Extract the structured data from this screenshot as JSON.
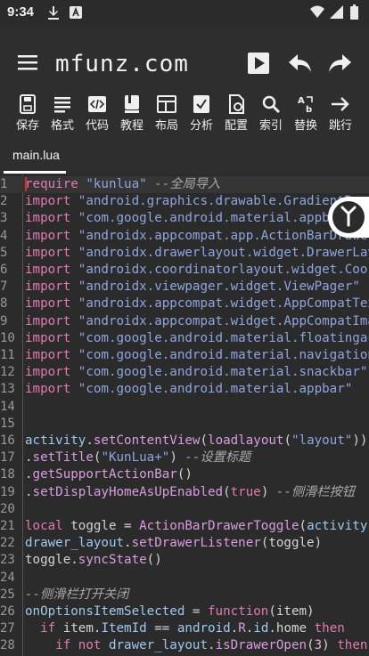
{
  "status_bar": {
    "time": "9:34"
  },
  "app_bar": {
    "title": "mfunz.com"
  },
  "toolbar": {
    "items": [
      {
        "label": "保存",
        "icon": "save-icon"
      },
      {
        "label": "格式",
        "icon": "format-icon"
      },
      {
        "label": "代码",
        "icon": "code-icon"
      },
      {
        "label": "教程",
        "icon": "book-icon"
      },
      {
        "label": "布局",
        "icon": "layout-icon"
      },
      {
        "label": "分析",
        "icon": "analyze-icon"
      },
      {
        "label": "配置",
        "icon": "config-icon"
      },
      {
        "label": "索引",
        "icon": "search-icon"
      },
      {
        "label": "替换",
        "icon": "replace-icon"
      },
      {
        "label": "跳行",
        "icon": "goto-line-icon"
      }
    ]
  },
  "tabs": [
    {
      "label": "main.lua",
      "active": true
    }
  ],
  "editor": {
    "lines": [
      {
        "n": "1",
        "segs": [
          [
            "kw",
            "require"
          ],
          [
            "pl",
            " "
          ],
          [
            "str",
            "\"kunlua\""
          ],
          [
            "pl",
            " "
          ],
          [
            "cm",
            "--全局导入"
          ]
        ]
      },
      {
        "n": "2",
        "segs": [
          [
            "kw",
            "import"
          ],
          [
            "pl",
            " "
          ],
          [
            "str",
            "\"android.graphics.drawable.GradientDrawable\""
          ]
        ]
      },
      {
        "n": "3",
        "segs": [
          [
            "kw",
            "import"
          ],
          [
            "pl",
            " "
          ],
          [
            "str",
            "\"com.google.android.material.appbar.AppBarLayout\""
          ]
        ]
      },
      {
        "n": "4",
        "segs": [
          [
            "kw",
            "import"
          ],
          [
            "pl",
            " "
          ],
          [
            "str",
            "\"androidx.appcompat.app.ActionBarDrawerToggle\""
          ]
        ]
      },
      {
        "n": "5",
        "segs": [
          [
            "kw",
            "import"
          ],
          [
            "pl",
            " "
          ],
          [
            "str",
            "\"androidx.drawerlayout.widget.DrawerLayout\""
          ]
        ]
      },
      {
        "n": "6",
        "segs": [
          [
            "kw",
            "import"
          ],
          [
            "pl",
            " "
          ],
          [
            "str",
            "\"androidx.coordinatorlayout.widget.CoordinatorLayout\""
          ]
        ]
      },
      {
        "n": "7",
        "segs": [
          [
            "kw",
            "import"
          ],
          [
            "pl",
            " "
          ],
          [
            "str",
            "\"androidx.viewpager.widget.ViewPager\""
          ]
        ]
      },
      {
        "n": "8",
        "segs": [
          [
            "kw",
            "import"
          ],
          [
            "pl",
            " "
          ],
          [
            "str",
            "\"androidx.appcompat.widget.AppCompatTextView\""
          ]
        ]
      },
      {
        "n": "9",
        "segs": [
          [
            "kw",
            "import"
          ],
          [
            "pl",
            " "
          ],
          [
            "str",
            "\"androidx.appcompat.widget.AppCompatImageView\""
          ]
        ]
      },
      {
        "n": "10",
        "segs": [
          [
            "kw",
            "import"
          ],
          [
            "pl",
            " "
          ],
          [
            "str",
            "\"com.google.android.material.floatingactionbutton\""
          ]
        ]
      },
      {
        "n": "11",
        "segs": [
          [
            "kw",
            "import"
          ],
          [
            "pl",
            " "
          ],
          [
            "str",
            "\"com.google.android.material.navigation\""
          ]
        ]
      },
      {
        "n": "12",
        "segs": [
          [
            "kw",
            "import"
          ],
          [
            "pl",
            " "
          ],
          [
            "str",
            "\"com.google.android.material.snackbar\""
          ]
        ]
      },
      {
        "n": "13",
        "segs": [
          [
            "kw",
            "import"
          ],
          [
            "pl",
            " "
          ],
          [
            "str",
            "\"com.google.android.material.appbar\""
          ]
        ]
      },
      {
        "n": "14",
        "segs": []
      },
      {
        "n": "15",
        "segs": []
      },
      {
        "n": "16",
        "segs": [
          [
            "id",
            "activity"
          ],
          [
            "pl",
            "."
          ],
          [
            "fn",
            "setContentView"
          ],
          [
            "pl",
            "("
          ],
          [
            "fn",
            "loadlayout"
          ],
          [
            "pl",
            "("
          ],
          [
            "str",
            "\"layout\""
          ],
          [
            "pl",
            "))"
          ]
        ]
      },
      {
        "n": "17",
        "segs": [
          [
            "pl",
            "."
          ],
          [
            "fn",
            "setTitle"
          ],
          [
            "pl",
            "("
          ],
          [
            "str",
            "\"KunLua+\""
          ],
          [
            "pl",
            ") "
          ],
          [
            "cm",
            "--设置标题"
          ]
        ]
      },
      {
        "n": "18",
        "segs": [
          [
            "pl",
            "."
          ],
          [
            "fn",
            "getSupportActionBar"
          ],
          [
            "pl",
            "()"
          ]
        ]
      },
      {
        "n": "19",
        "segs": [
          [
            "pl",
            "."
          ],
          [
            "fn",
            "setDisplayHomeAsUpEnabled"
          ],
          [
            "pl",
            "("
          ],
          [
            "kw",
            "true"
          ],
          [
            "pl",
            ") "
          ],
          [
            "cm",
            "--侧滑栏按钮"
          ]
        ]
      },
      {
        "n": "20",
        "segs": []
      },
      {
        "n": "21",
        "segs": [
          [
            "kw",
            "local"
          ],
          [
            "pl",
            " toggle = "
          ],
          [
            "fn",
            "ActionBarDrawerToggle"
          ],
          [
            "pl",
            "("
          ],
          [
            "id",
            "activity"
          ],
          [
            "pl",
            ")"
          ]
        ]
      },
      {
        "n": "22",
        "segs": [
          [
            "id",
            "drawer_layout"
          ],
          [
            "pl",
            "."
          ],
          [
            "fn",
            "setDrawerListener"
          ],
          [
            "pl",
            "(toggle)"
          ]
        ]
      },
      {
        "n": "23",
        "segs": [
          [
            "pl",
            "toggle."
          ],
          [
            "fn",
            "syncState"
          ],
          [
            "pl",
            "()"
          ]
        ]
      },
      {
        "n": "24",
        "segs": []
      },
      {
        "n": "25",
        "segs": [
          [
            "cm",
            "--侧滑栏打开关闭"
          ]
        ]
      },
      {
        "n": "26",
        "segs": [
          [
            "id",
            "onOptionsItemSelected"
          ],
          [
            "pl",
            " = "
          ],
          [
            "kw",
            "function"
          ],
          [
            "pl",
            "(item)"
          ]
        ]
      },
      {
        "n": "27",
        "segs": [
          [
            "pl",
            "  "
          ],
          [
            "kw",
            "if"
          ],
          [
            "pl",
            " item."
          ],
          [
            "id",
            "ItemId"
          ],
          [
            "pl",
            " == "
          ],
          [
            "id",
            "android"
          ],
          [
            "pl",
            "."
          ],
          [
            "fn",
            "R"
          ],
          [
            "pl",
            "."
          ],
          [
            "id",
            "id"
          ],
          [
            "pl",
            ".home "
          ],
          [
            "kw",
            "then"
          ]
        ]
      },
      {
        "n": "28",
        "segs": [
          [
            "pl",
            "    "
          ],
          [
            "kw",
            "if not"
          ],
          [
            "pl",
            " "
          ],
          [
            "id",
            "drawer_layout"
          ],
          [
            "pl",
            "."
          ],
          [
            "fn",
            "isDrawerOpen"
          ],
          [
            "pl",
            "("
          ],
          [
            "bl",
            "3"
          ],
          [
            "pl",
            ") "
          ],
          [
            "kw",
            "then"
          ]
        ]
      }
    ]
  }
}
